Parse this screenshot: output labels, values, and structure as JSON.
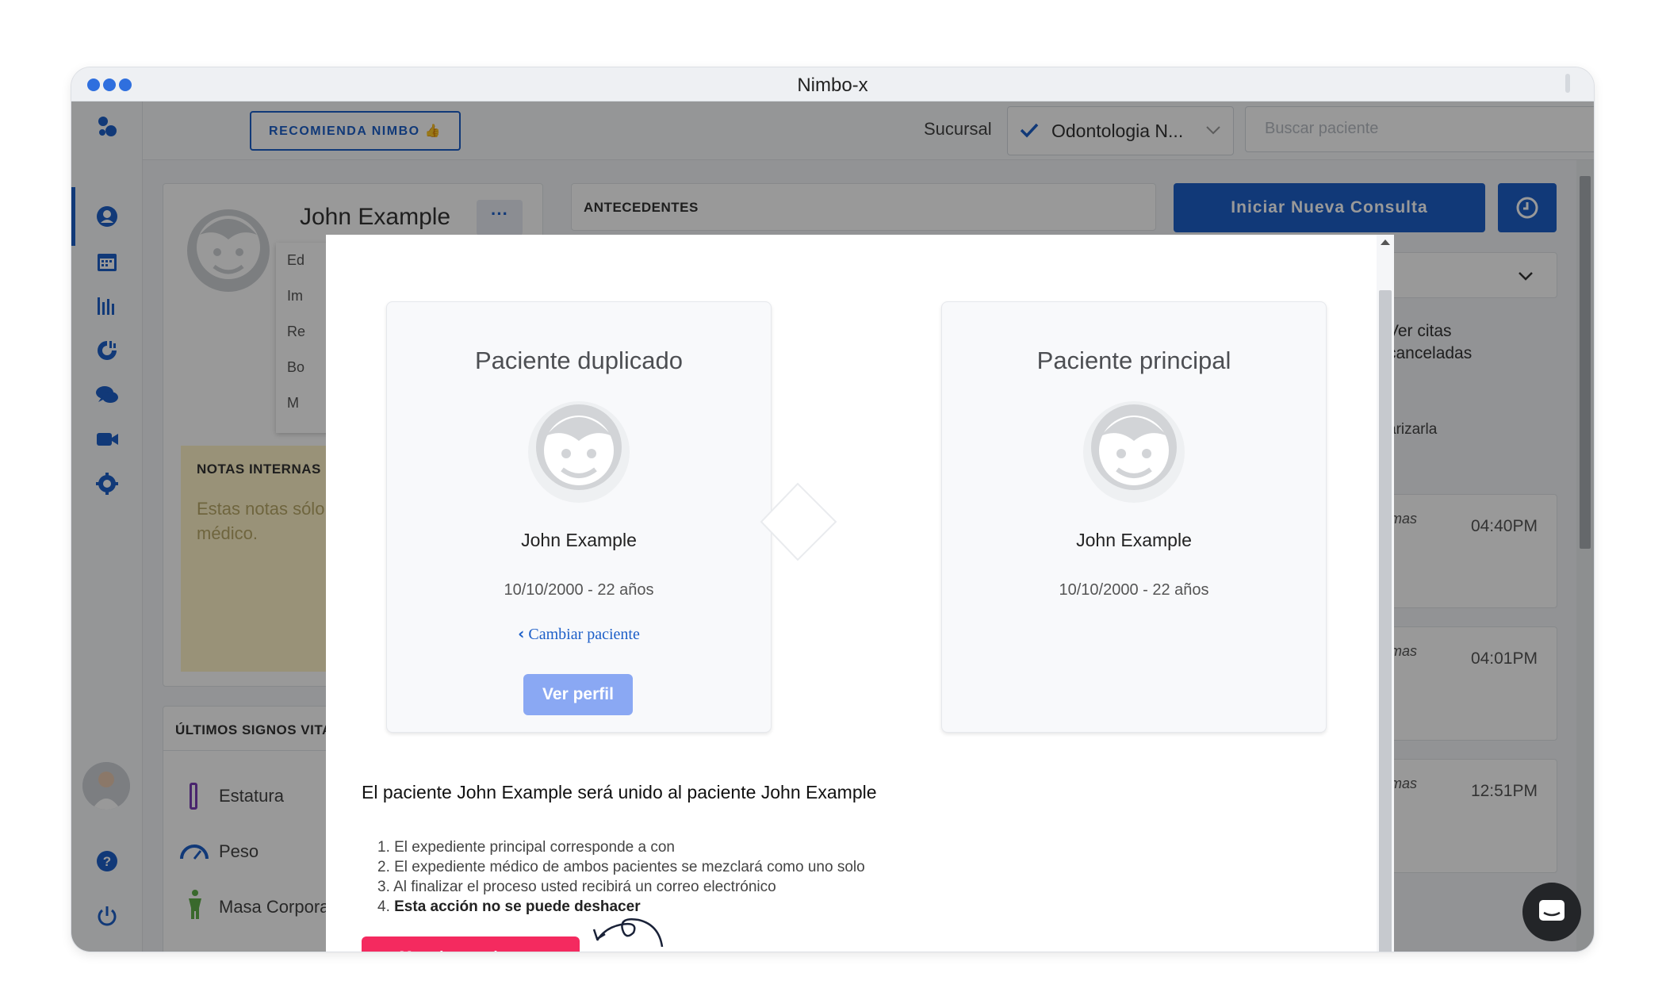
{
  "window": {
    "title": "Nimbo-x"
  },
  "topbar": {
    "recommend_label": "RECOMIENDA NIMBO 👍",
    "branch_label": "Sucursal",
    "branch_value": "Odontologia N...",
    "search_placeholder": "Buscar paciente"
  },
  "patient": {
    "name": "John Example",
    "menu_items": [
      "Ed",
      "Im",
      "Re",
      "Bo",
      "M"
    ]
  },
  "sections": {
    "antecedentes": "ANTECEDENTES",
    "notas_title": "NOTAS INTERNAS",
    "notas_placeholder_1": "Estas notas sólo",
    "notas_placeholder_2": "médico.",
    "vitals_title": "ÚLTIMOS SIGNOS VITA",
    "vitals": [
      "Estatura",
      "Peso",
      "Masa Corpora"
    ]
  },
  "right_panel": {
    "new_consult": "Iniciar Nueva Consulta",
    "canceled_1": "Ver citas",
    "canceled_2": "canceladas",
    "hint": "arizarla",
    "appointments": [
      {
        "label": "mas",
        "time": "04:40PM"
      },
      {
        "label": "mas",
        "time": "04:01PM"
      },
      {
        "label": "mas",
        "time": "12:51PM"
      }
    ]
  },
  "modal": {
    "duplicate": {
      "heading": "Paciente duplicado",
      "name": "John Example",
      "dob": "10/10/2000 - 22 años",
      "change_link": "Cambiar paciente",
      "profile_button": "Ver perfil"
    },
    "principal": {
      "heading": "Paciente principal",
      "name": "John Example",
      "dob": "10/10/2000 - 22 años"
    },
    "merge_title": "El paciente John Example será unido al paciente John Example",
    "steps": [
      "El expediente principal corresponde a con",
      "El expediente médico de ambos pacientes se mezclará como uno solo",
      "Al finalizar el proceso usted recibirá un correo electrónico",
      "Esta acción no se puede deshacer"
    ],
    "merge_button": "Mezclar pacientes"
  },
  "colors": {
    "primary": "#1d5fc8",
    "danger": "#f42a5f",
    "soft_primary": "#8aa8f3"
  }
}
